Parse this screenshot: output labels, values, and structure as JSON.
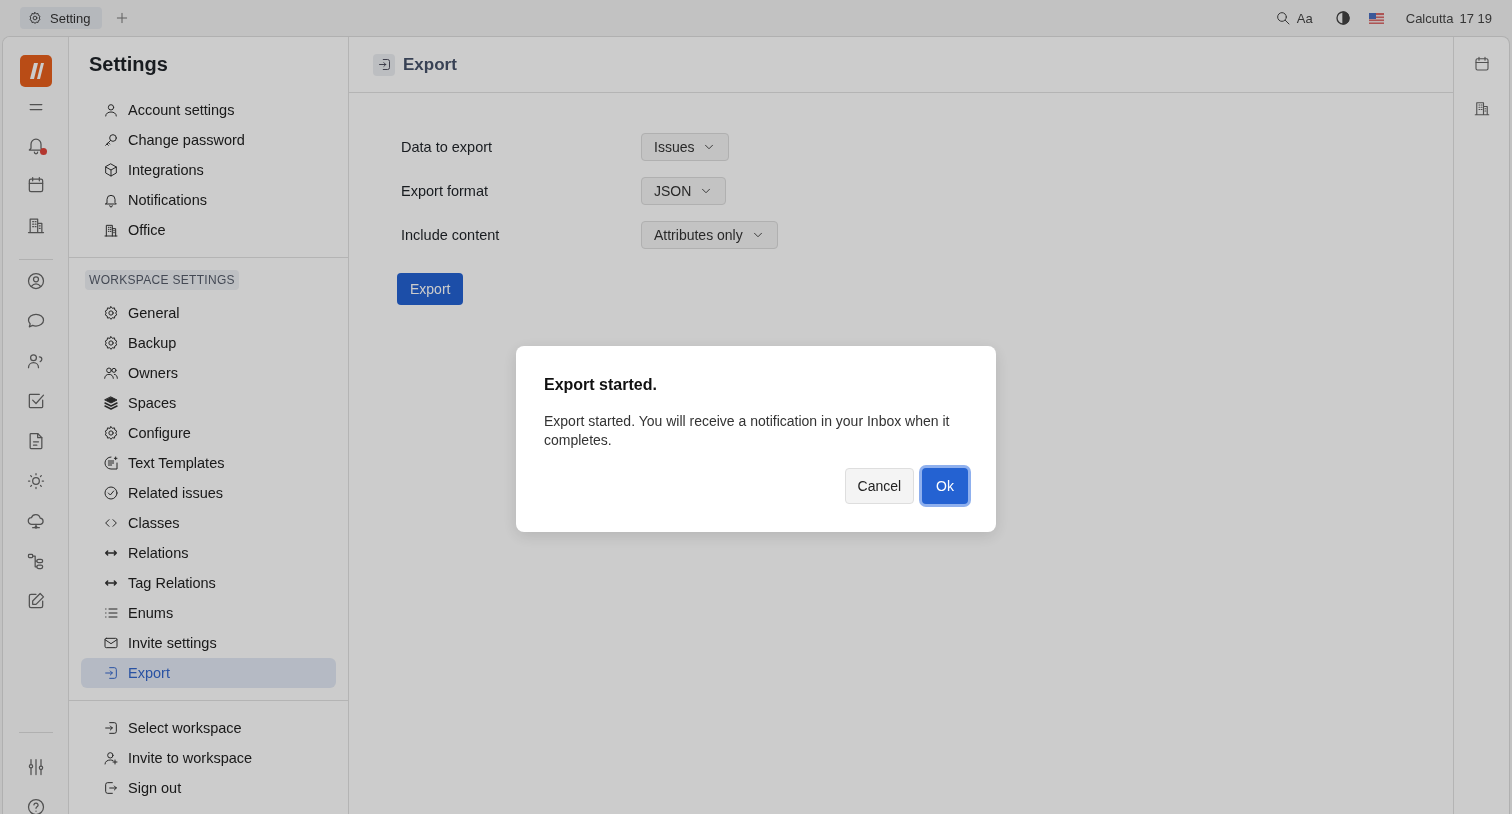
{
  "top_bar": {
    "tabs": [
      {
        "label": "Setting",
        "selected": true
      }
    ],
    "font_button": "Aa",
    "location": "Calcutta",
    "time": "17 19"
  },
  "nav_rail": {
    "top_items": [
      {
        "kind": "menu",
        "unread": false
      },
      {
        "kind": "bell",
        "unread": true
      },
      {
        "kind": "calendar",
        "unread": false
      },
      {
        "kind": "office",
        "unread": false
      }
    ],
    "middle_items": [
      {
        "kind": "user-circle",
        "unread": false
      },
      {
        "kind": "chat",
        "unread": false
      },
      {
        "kind": "people-talk",
        "unread": false
      },
      {
        "kind": "checkbox",
        "unread": false
      },
      {
        "kind": "document",
        "unread": false
      },
      {
        "kind": "sun",
        "unread": false
      },
      {
        "kind": "cloud",
        "unread": false
      },
      {
        "kind": "tree",
        "unread": false
      },
      {
        "kind": "edit",
        "unread": false
      }
    ],
    "bottom_items": [
      {
        "kind": "sliders",
        "unread": false
      },
      {
        "kind": "help",
        "unread": false
      }
    ]
  },
  "settings_sidebar": {
    "title": "Settings",
    "account_items": [
      {
        "kind": "person",
        "label": "Account settings",
        "selected": false
      },
      {
        "kind": "key",
        "label": "Change password",
        "selected": false
      },
      {
        "kind": "cube",
        "label": "Integrations",
        "selected": false
      },
      {
        "kind": "bell",
        "label": "Notifications",
        "selected": false
      },
      {
        "kind": "office",
        "label": "Office",
        "selected": false
      }
    ],
    "section_heading": "WORKSPACE SETTINGS",
    "workspace_items": [
      {
        "kind": "gear",
        "label": "General",
        "selected": false
      },
      {
        "kind": "gear",
        "label": "Backup",
        "selected": false
      },
      {
        "kind": "people",
        "label": "Owners",
        "selected": false
      },
      {
        "kind": "layers",
        "label": "Spaces",
        "selected": false
      },
      {
        "kind": "gear",
        "label": "Configure",
        "selected": false
      },
      {
        "kind": "templates",
        "label": "Text Templates",
        "selected": false
      },
      {
        "kind": "check-circle",
        "label": "Related issues",
        "selected": false
      },
      {
        "kind": "code",
        "label": "Classes",
        "selected": false
      },
      {
        "kind": "arrows",
        "label": "Relations",
        "selected": false
      },
      {
        "kind": "arrows",
        "label": "Tag Relations",
        "selected": false
      },
      {
        "kind": "list",
        "label": "Enums",
        "selected": false
      },
      {
        "kind": "mail",
        "label": "Invite settings",
        "selected": false
      },
      {
        "kind": "enter",
        "label": "Export",
        "selected": true
      }
    ],
    "bottom_items": [
      {
        "kind": "enter",
        "label": "Select workspace",
        "selected": false
      },
      {
        "kind": "person-plus",
        "label": "Invite to workspace",
        "selected": false
      },
      {
        "kind": "signout",
        "label": "Sign out",
        "selected": false
      }
    ]
  },
  "page": {
    "title": "Export",
    "fields": [
      {
        "label": "Data to export",
        "value": "Issues"
      },
      {
        "label": "Export format",
        "value": "JSON"
      },
      {
        "label": "Include content",
        "value": "Attributes only"
      }
    ],
    "export_button": "Export"
  },
  "right_rail": {
    "items": [
      {
        "kind": "calendar"
      },
      {
        "kind": "office"
      }
    ]
  },
  "dialog": {
    "title": "Export started.",
    "message": "Export started. You will receive a notification in your Inbox when it completes.",
    "buttons": [
      {
        "label": "Cancel",
        "kind": "secondary"
      },
      {
        "label": "Ok",
        "kind": "primary"
      }
    ]
  }
}
